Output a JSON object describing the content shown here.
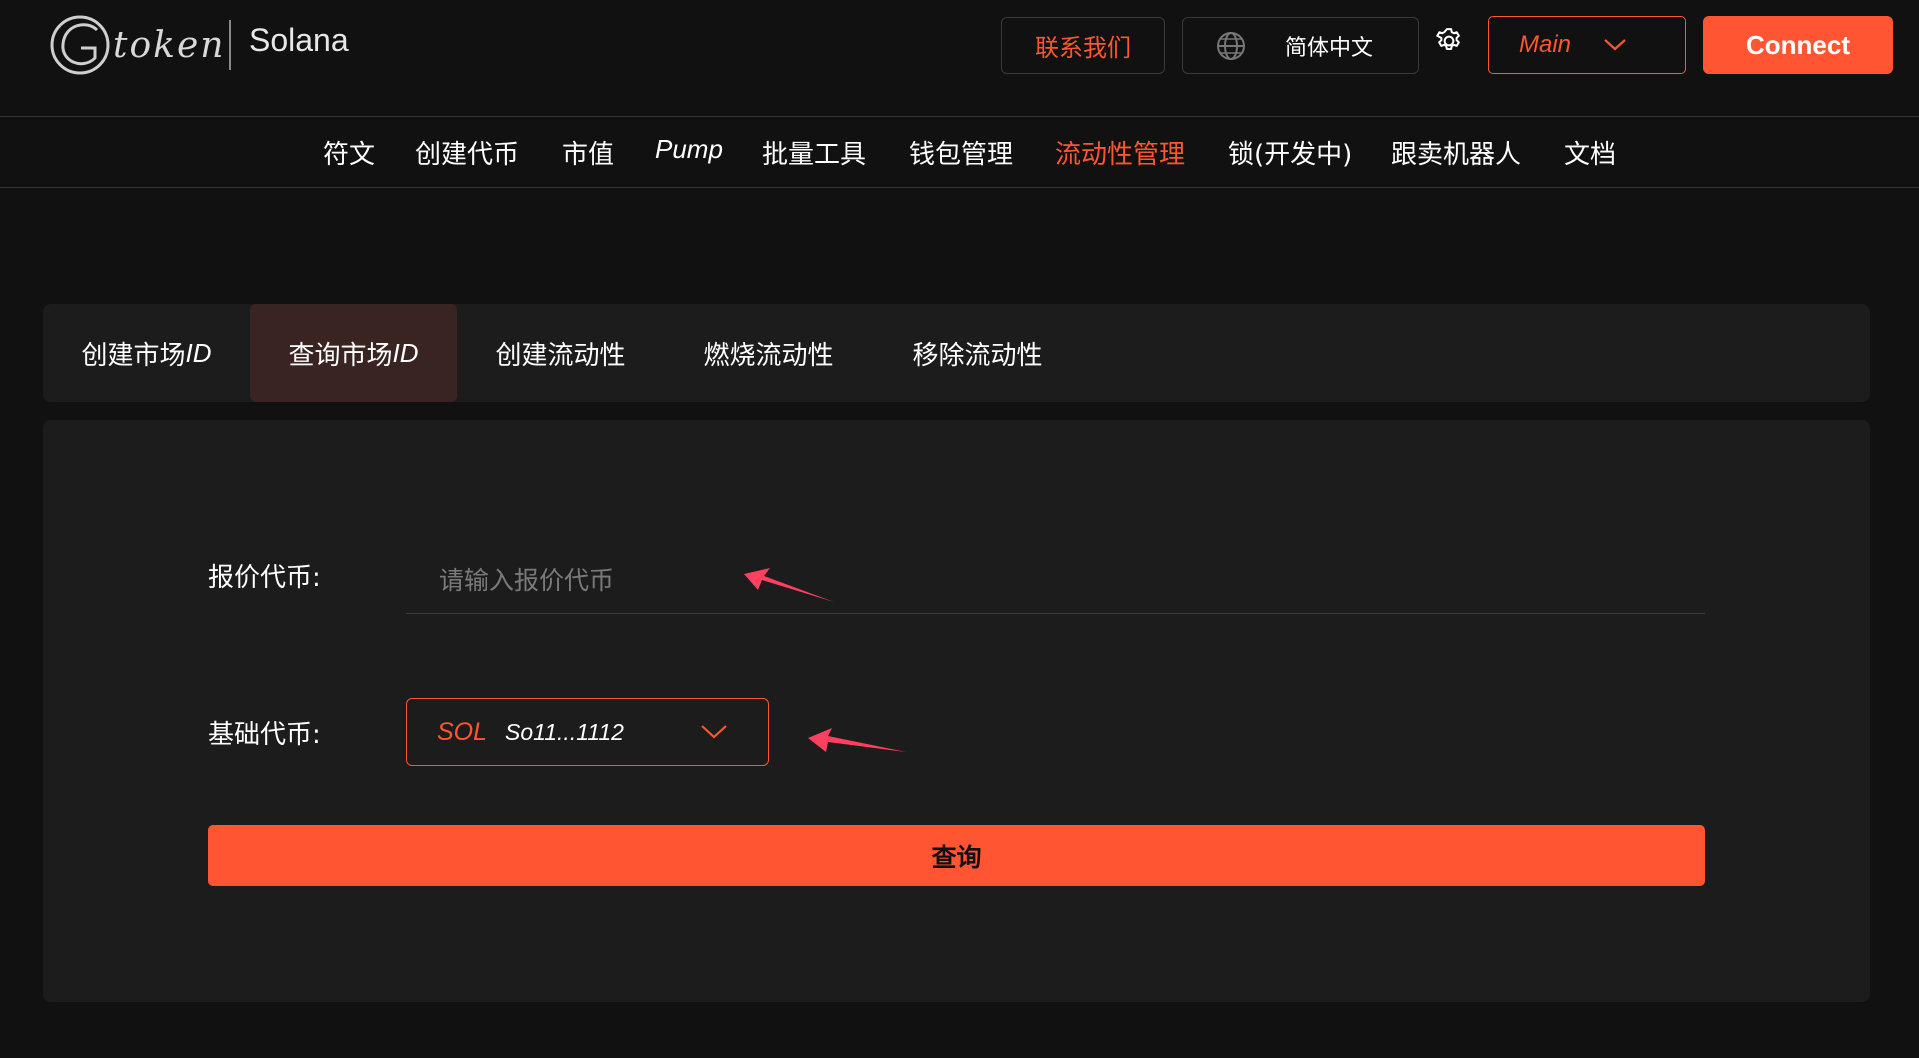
{
  "header": {
    "logo_text": "token",
    "chain_name": "Solana",
    "contact_label": "联系我们",
    "language_label": "简体中文",
    "network_selected": "Main",
    "connect_label": "Connect"
  },
  "nav": {
    "items": [
      {
        "label": "符文"
      },
      {
        "label": "创建代币"
      },
      {
        "label": "市值"
      },
      {
        "label": "Pump"
      },
      {
        "label": "批量工具"
      },
      {
        "label": "钱包管理"
      },
      {
        "label": "流动性管理",
        "active": true
      },
      {
        "label": "锁(开发中)"
      },
      {
        "label": "跟卖机器人"
      },
      {
        "label": "文档"
      }
    ]
  },
  "tabs": [
    {
      "label": "创建市场",
      "suffix": "ID"
    },
    {
      "label": "查询市场",
      "suffix": "ID",
      "active": true
    },
    {
      "label": "创建流动性",
      "suffix": ""
    },
    {
      "label": "燃烧流动性",
      "suffix": ""
    },
    {
      "label": "移除流动性",
      "suffix": ""
    }
  ],
  "form": {
    "quote_label": "报价代币:",
    "quote_placeholder": "请输入报价代币",
    "quote_value": "",
    "base_label": "基础代币:",
    "base_symbol": "SOL",
    "base_address": "So11...1112",
    "query_label": "查询"
  },
  "colors": {
    "accent": "#ff5533",
    "background": "#111111",
    "panel": "#1c1c1c",
    "active_tab": "#3a2422",
    "annotation_arrow": "#ff4060"
  },
  "icons": {
    "logo": "g-token-logo",
    "language": "globe-icon",
    "settings": "gear-icon",
    "dropdown": "chevron-down-icon",
    "annotation": "arrow-annotation-icon"
  }
}
